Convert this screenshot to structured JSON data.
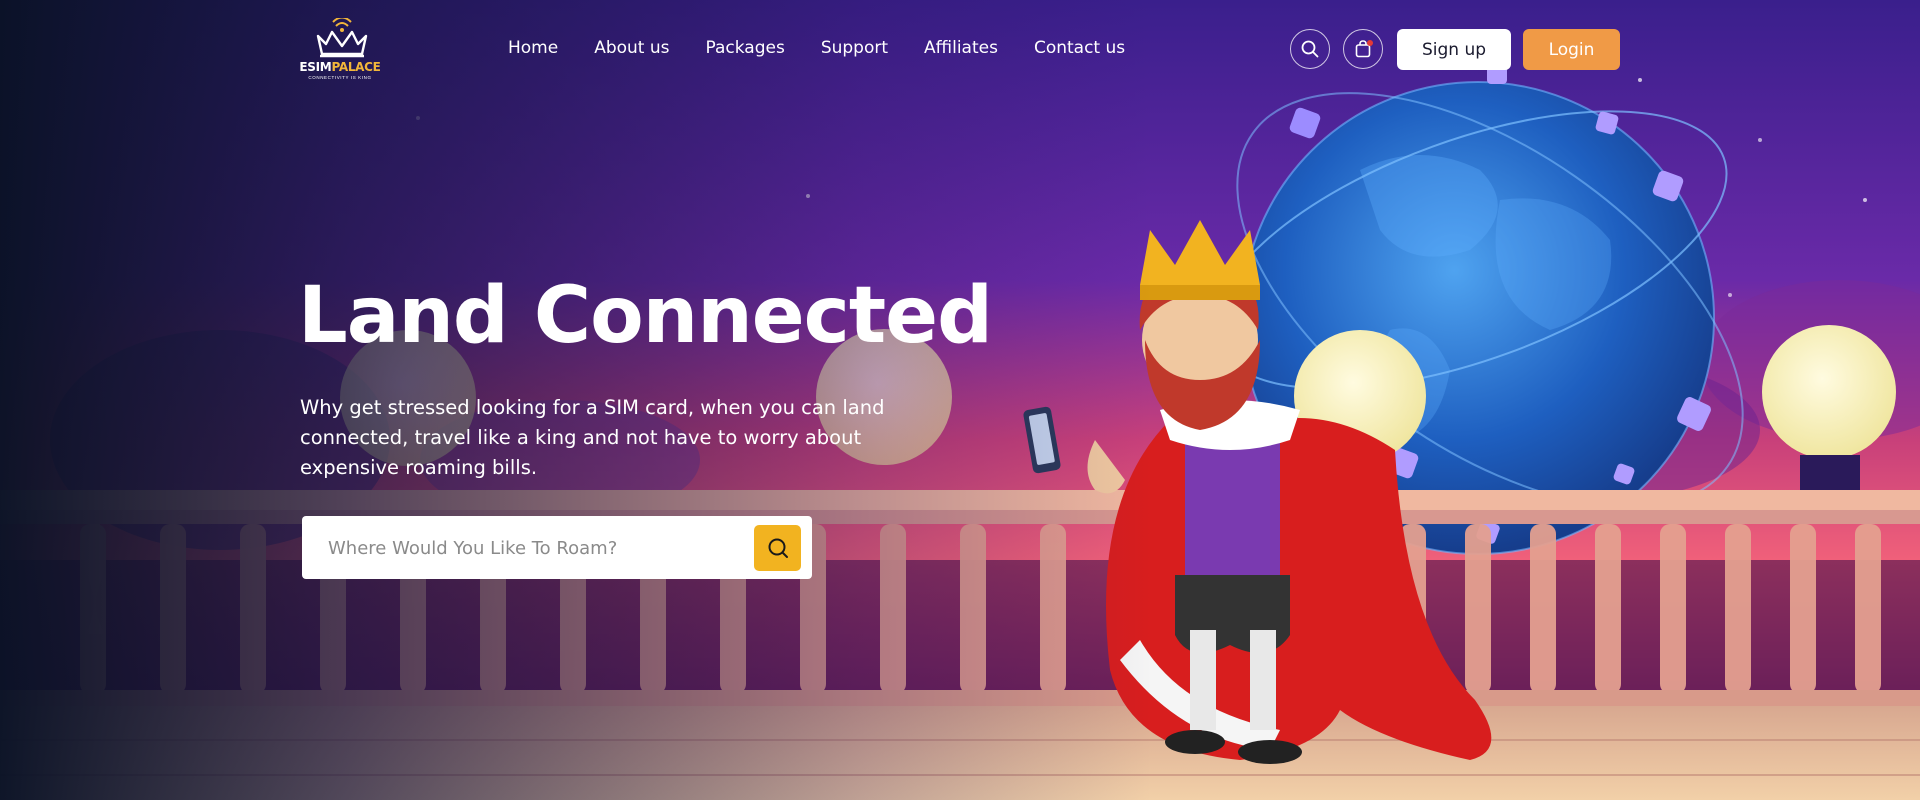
{
  "brand": {
    "name_part1": "ESIM",
    "name_part2": "PALACE",
    "tagline": "CONNECTIVITY IS KING",
    "accent_color": "#f2b63a"
  },
  "nav": {
    "items": [
      {
        "label": "Home"
      },
      {
        "label": "About us"
      },
      {
        "label": "Packages"
      },
      {
        "label": "Support"
      },
      {
        "label": "Affiliates"
      },
      {
        "label": "Contact us"
      }
    ]
  },
  "header": {
    "search_icon": "search-icon",
    "cart_icon": "shopping-bag-icon",
    "signup_label": "Sign up",
    "login_label": "Login",
    "login_color": "#f09a46"
  },
  "hero": {
    "title": "Land Connected",
    "subtitle": "Why get stressed looking for a SIM card, when you can land connected,  travel like a king and not have to worry about expensive roaming bills.",
    "search_placeholder": "Where Would You Like To Roam?",
    "search_button_icon": "search-icon",
    "search_button_color": "#f2b320"
  },
  "illustration": {
    "subject": "king-character-with-phone",
    "background": "globe-and-balcony-scene"
  }
}
